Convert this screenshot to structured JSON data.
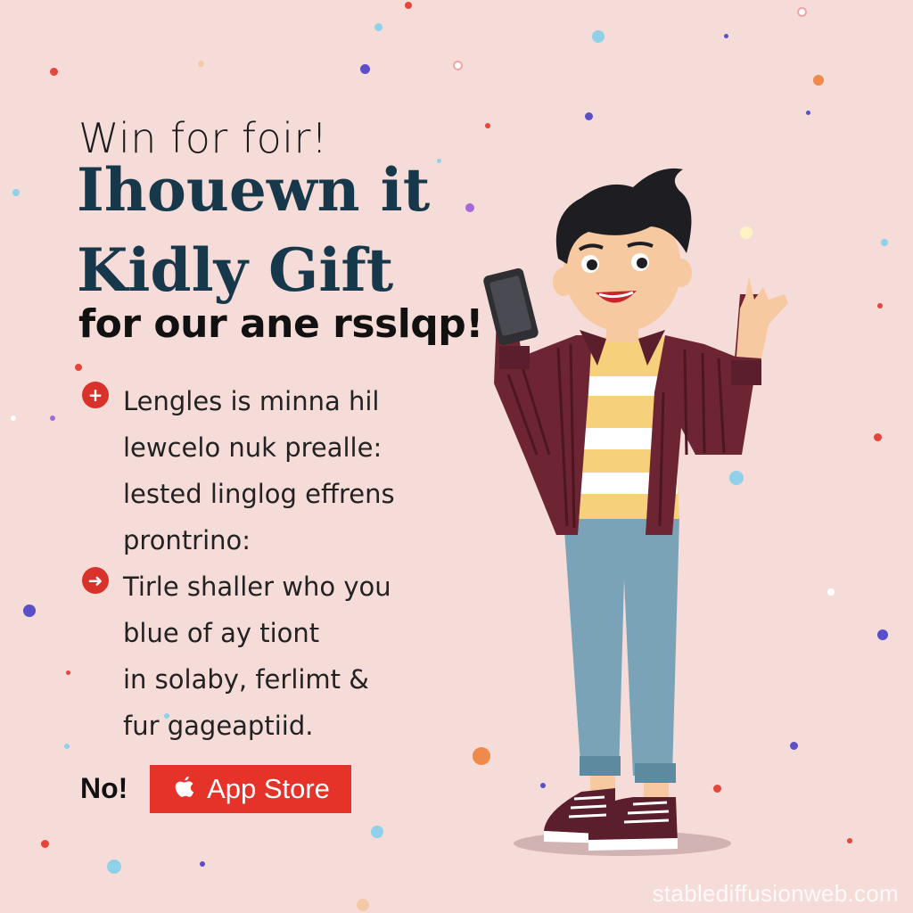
{
  "poster": {
    "eyebrow": "Win for foir!",
    "headline_line1": "Ihouewn it",
    "headline_line2": "Kidly Gift",
    "subhead": "for our ane rsslqp!"
  },
  "bullets": [
    {
      "icon": "plus-icon",
      "lines": [
        "Lengles is minna hil",
        "lewcelo nuk prealle:",
        "lested linglog effrens",
        "prontrino:"
      ]
    },
    {
      "icon": "arrow-right-icon",
      "lines": [
        "Tirle shaller who you",
        "blue of ay tiont",
        "in solaby, ferlimt &",
        "fur gageaptiid."
      ]
    }
  ],
  "cta": {
    "label": "No!",
    "button_label": "App Store",
    "button_icon": "apple-icon"
  },
  "watermark": "stablediffusionweb.com",
  "colors": {
    "background": "#f6dcd8",
    "headline": "#17384a",
    "accent_red": "#e5332a"
  }
}
